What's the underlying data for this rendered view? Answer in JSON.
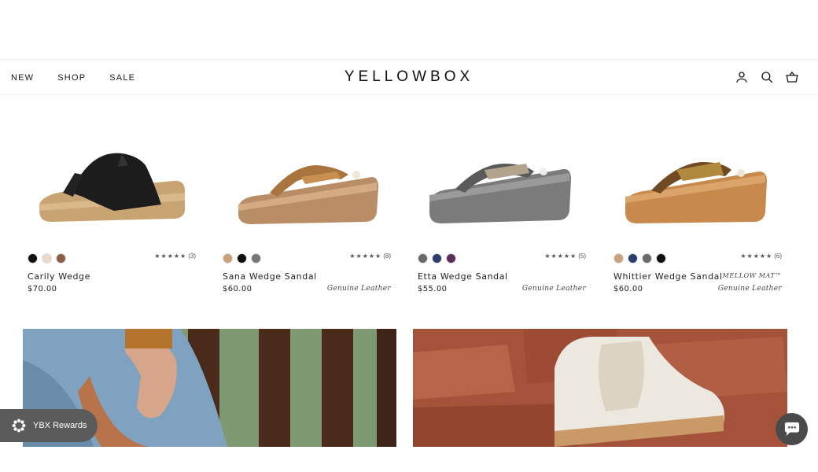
{
  "header": {
    "nav": [
      "NEW",
      "SHOP",
      "SALE"
    ],
    "logo": "YELLOWBOX",
    "icons": [
      "account-icon",
      "search-icon",
      "cart-icon"
    ]
  },
  "products": [
    {
      "name": "Carily Wedge",
      "price": "$70.00",
      "rating_stars": "★★★★★",
      "review_count": "(3)",
      "tag_line1": "",
      "tag_line2": "",
      "swatches": [
        "#111111",
        "#e8d9c8",
        "#8b5e45"
      ]
    },
    {
      "name": "Sana Wedge Sandal",
      "price": "$60.00",
      "rating_stars": "★★★★★",
      "review_count": "(8)",
      "tag_line1": "",
      "tag_line2": "Genuine Leather",
      "swatches": [
        "#c9a17b",
        "#111111",
        "#777777"
      ]
    },
    {
      "name": "Etta Wedge Sandal",
      "price": "$55.00",
      "rating_stars": "★★★★★",
      "review_count": "(5)",
      "tag_line1": "",
      "tag_line2": "Genuine Leather",
      "swatches": [
        "#6a6a6a",
        "#2c3e6b",
        "#5a2d5a"
      ]
    },
    {
      "name": "Whittier Wedge Sandal",
      "price": "$60.00",
      "rating_stars": "★★★★★",
      "review_count": "(6)",
      "tag_line1": "MELLOW MAT™",
      "tag_line2": "Genuine Leather",
      "swatches": [
        "#c9a17b",
        "#2c3e6b",
        "#6a6a6a",
        "#111111"
      ]
    }
  ],
  "rewards": {
    "label": "YBX Rewards"
  },
  "colors": {
    "text": "#1a1a1a",
    "rewards_bg": "#5b5b5b",
    "chat_bg": "#4a4a4a"
  }
}
